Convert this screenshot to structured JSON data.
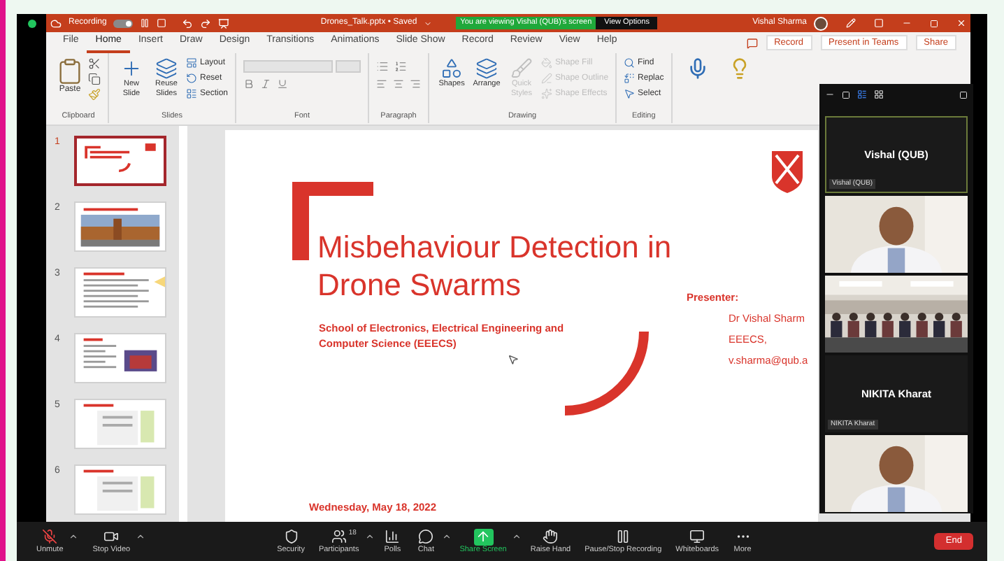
{
  "title_bar": {
    "recording_label": "Recording",
    "toggle": {
      "on": true
    },
    "document_title": "Drones_Talk.pptx • Saved",
    "viewing_banner": "You are viewing Vishal (QUB)'s screen",
    "view_options": "View Options",
    "user_name": "Vishal Sharma"
  },
  "ribbon_tabs": [
    {
      "label": "File",
      "selected": false
    },
    {
      "label": "Home",
      "selected": true
    },
    {
      "label": "Insert",
      "selected": false
    },
    {
      "label": "Draw",
      "selected": false
    },
    {
      "label": "Design",
      "selected": false
    },
    {
      "label": "Transitions",
      "selected": false
    },
    {
      "label": "Animations",
      "selected": false
    },
    {
      "label": "Slide Show",
      "selected": false
    },
    {
      "label": "Record",
      "selected": false
    },
    {
      "label": "Review",
      "selected": false
    },
    {
      "label": "View",
      "selected": false
    },
    {
      "label": "Help",
      "selected": false
    }
  ],
  "ribbon_actions": [
    "Record",
    "Present in Teams",
    "Share"
  ],
  "ribbon_groups": [
    {
      "name": "Clipboard",
      "items": [
        {
          "label": "Paste",
          "kind": "large"
        }
      ]
    },
    {
      "name": "Slides",
      "items": [
        {
          "label": "New Slide",
          "kind": "large"
        },
        {
          "label": "Reuse Slides",
          "kind": "large"
        },
        {
          "label": "Layout",
          "kind": "small"
        },
        {
          "label": "Reset",
          "kind": "small"
        },
        {
          "label": "Section",
          "kind": "small"
        }
      ]
    },
    {
      "name": "Font"
    },
    {
      "name": "Paragraph"
    },
    {
      "name": "Drawing",
      "items": [
        {
          "label": "Shapes",
          "kind": "large",
          "disabled": false
        },
        {
          "label": "Arrange",
          "kind": "large",
          "disabled": false
        },
        {
          "label": "Quick Styles",
          "kind": "large",
          "disabled": true
        },
        {
          "label": "Shape Fill",
          "kind": "small",
          "disabled": true
        },
        {
          "label": "Shape Outline",
          "kind": "small",
          "disabled": true
        },
        {
          "label": "Shape Effects",
          "kind": "small",
          "disabled": true
        }
      ]
    },
    {
      "name": "Editing",
      "items": [
        {
          "label": "Find",
          "kind": "small"
        },
        {
          "label": "Replac",
          "kind": "small"
        },
        {
          "label": "Select",
          "kind": "small"
        }
      ]
    }
  ],
  "thumbnails": [
    {
      "number": "1",
      "selected": true
    },
    {
      "number": "2",
      "selected": false
    },
    {
      "number": "3",
      "selected": false
    },
    {
      "number": "4",
      "selected": false
    },
    {
      "number": "5",
      "selected": false
    },
    {
      "number": "6",
      "selected": false
    }
  ],
  "slide": {
    "title": "Misbehaviour Detection in Drone Swarms",
    "subtitle": "School of Electronics, Electrical Engineering and Computer Science (EEECS)",
    "presenter_label": "Presenter:",
    "presenter_lines": [
      "Dr Vishal Sharm",
      "EEECS,",
      "v.sharma@qub.a"
    ],
    "date": "Wednesday, May 18, 2022"
  },
  "video_panel": {
    "tiles": [
      {
        "kind": "name",
        "name": "Vishal (QUB)",
        "label": "Vishal (QUB)"
      },
      {
        "kind": "video"
      },
      {
        "kind": "room"
      },
      {
        "kind": "name",
        "name": "NIKITA Kharat",
        "label": "NIKITA Kharat"
      },
      {
        "kind": "video"
      }
    ]
  },
  "toolbar": {
    "left": [
      {
        "label": "Unmute",
        "muted": true
      },
      {
        "label": "Stop Video"
      }
    ],
    "center": [
      {
        "label": "Security"
      },
      {
        "label": "Participants",
        "count": "18"
      },
      {
        "label": "Polls"
      },
      {
        "label": "Chat"
      },
      {
        "label": "Share Screen",
        "highlight": true
      },
      {
        "label": "Raise Hand"
      },
      {
        "label": "Pause/Stop Recording"
      },
      {
        "label": "Whiteboards"
      },
      {
        "label": "More"
      }
    ],
    "end": "End"
  }
}
